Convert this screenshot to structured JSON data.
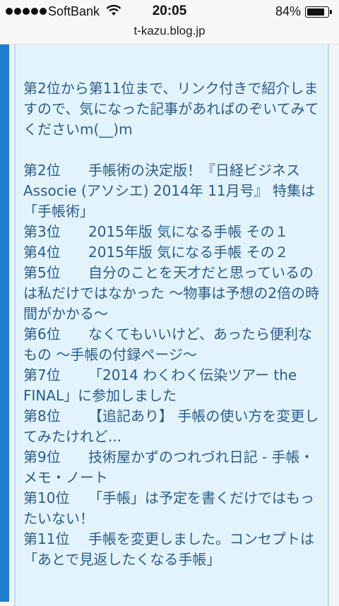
{
  "status_bar": {
    "carrier": "SoftBank",
    "time": "20:05",
    "battery": "84%",
    "battery_level": 0.84
  },
  "browser": {
    "url": "t-kazu.blog.jp"
  },
  "article": {
    "intro": "第2位から第11位まで、リンク付きで紹介しますので、気になった記事があればのぞいてみてくださいm(__)m",
    "items": [
      {
        "rank": "第2位",
        "title": "手帳術の決定版！『日経ビジネス Associe (アソシエ) 2014年 11月号』 特集は「手帳術」"
      },
      {
        "rank": "第3位",
        "title": "2015年版 気になる手帳 その１"
      },
      {
        "rank": "第4位",
        "title": "2015年版 気になる手帳 その２"
      },
      {
        "rank": "第5位",
        "title": "自分のことを天才だと思っているのは私だけではなかった 〜物事は予想の2倍の時間がかかる〜"
      },
      {
        "rank": "第6位",
        "title": "なくてもいいけど、あったら便利なもの 〜手帳の付録ページ〜"
      },
      {
        "rank": "第7位",
        "title": "「2014 わくわく伝染ツアー the FINAL」に参加しました"
      },
      {
        "rank": "第8位",
        "title": "【追記あり】 手帳の使い方を変更してみたけれど..."
      },
      {
        "rank": "第9位",
        "title": "技術屋かずのつれづれ日記 - 手帳・メモ・ノート"
      },
      {
        "rank": "第10位",
        "title": "「手帳」は予定を書くだけではもったいない！"
      },
      {
        "rank": "第11位",
        "title": "手帳を変更しました。コンセプトは「あとで見返したくなる手帳」"
      }
    ]
  }
}
